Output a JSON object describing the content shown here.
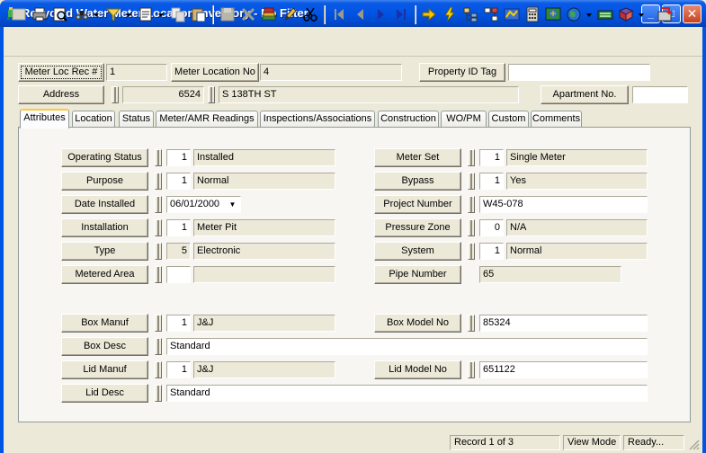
{
  "window": {
    "title": "Recycled Water Meter Location Inventory - No Filter",
    "minimize": "_",
    "maximize": "□",
    "close": "✕"
  },
  "header": {
    "meter_loc_rec_label": "Meter Loc Rec #",
    "meter_loc_rec_value": "1",
    "meter_location_no_label": "Meter Location No",
    "meter_location_no_value": "4",
    "property_id_label": "Property ID Tag",
    "property_id_value": "",
    "address_label": "Address",
    "address_number": "6524",
    "address_street": "S 138TH ST",
    "apartment_label": "Apartment No.",
    "apartment_value": ""
  },
  "tabs": [
    {
      "label": "Attributes"
    },
    {
      "label": "Location"
    },
    {
      "label": "Status"
    },
    {
      "label": "Meter/AMR Readings"
    },
    {
      "label": "Inspections/Associations"
    },
    {
      "label": "Construction"
    },
    {
      "label": "WO/PM"
    },
    {
      "label": "Custom"
    },
    {
      "label": "Comments"
    }
  ],
  "attributes": {
    "operating_status": {
      "label": "Operating Status",
      "code": "1",
      "value": "Installed"
    },
    "purpose": {
      "label": "Purpose",
      "code": "1",
      "value": "Normal"
    },
    "date_installed": {
      "label": "Date Installed",
      "value": "06/01/2000"
    },
    "installation": {
      "label": "Installation",
      "code": "1",
      "value": "Meter Pit"
    },
    "type": {
      "label": "Type",
      "code": "5",
      "value": "Electronic"
    },
    "metered_area": {
      "label": "Metered Area",
      "code": "",
      "value": ""
    },
    "meter_set": {
      "label": "Meter Set",
      "code": "1",
      "value": "Single Meter"
    },
    "bypass": {
      "label": "Bypass",
      "code": "1",
      "value": "Yes"
    },
    "project_number": {
      "label": "Project Number",
      "value": "W45-078"
    },
    "pressure_zone": {
      "label": "Pressure Zone",
      "code": "0",
      "value": "N/A"
    },
    "system": {
      "label": "System",
      "code": "1",
      "value": "Normal"
    },
    "pipe_number": {
      "label": "Pipe Number",
      "value": "65"
    },
    "box_manuf": {
      "label": "Box Manuf",
      "code": "1",
      "value": "J&J"
    },
    "box_model_no": {
      "label": "Box Model No",
      "value": "85324"
    },
    "box_desc": {
      "label": "Box Desc",
      "value": "Standard"
    },
    "lid_manuf": {
      "label": "Lid Manuf",
      "code": "1",
      "value": "J&J"
    },
    "lid_model_no": {
      "label": "Lid Model No",
      "value": "651122"
    },
    "lid_desc": {
      "label": "Lid Desc",
      "value": "Standard"
    }
  },
  "status_bar": {
    "record": "Record 1 of 3",
    "mode": "View Mode",
    "state": "Ready..."
  },
  "toolbar_icons": [
    "new-icon",
    "print-icon",
    "print-preview-icon",
    "binoculars-icon",
    "filter-icon",
    "report-icon",
    "copy-icon",
    "paste-icon",
    "save-icon",
    "delete-icon",
    "stack-icon",
    "edit-icon",
    "cut-icon",
    "first-record-icon",
    "previous-record-icon",
    "next-record-icon",
    "last-record-icon",
    "arrow-right-icon",
    "lightning-icon",
    "tree-icon",
    "network-icon",
    "map-icon",
    "calculator-icon",
    "gis-icon",
    "globe-icon",
    "keyboard-icon",
    "book-icon",
    "exit-icon"
  ],
  "colors": {
    "titlebar": "#0054e3",
    "face": "#ece9d8",
    "tab_highlight": "#ffc83c"
  }
}
